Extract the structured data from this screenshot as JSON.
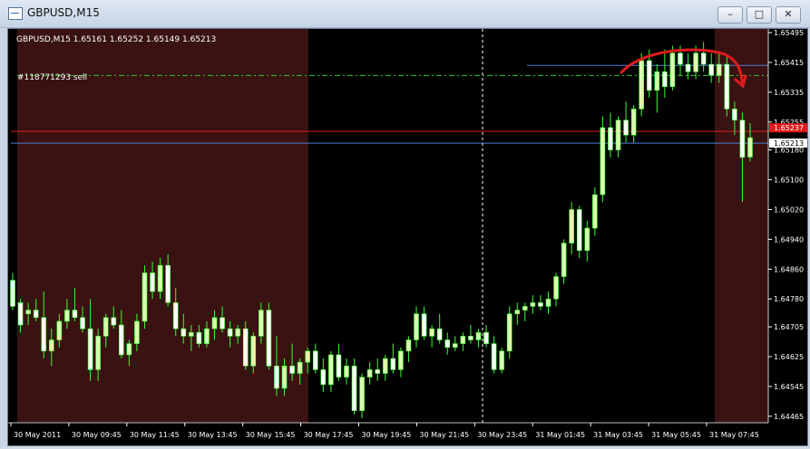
{
  "window": {
    "title": "GBPUSD,M15",
    "buttons": {
      "minimize": "–",
      "maximize": "□",
      "close": "✕"
    }
  },
  "chart_info": "GBPUSD,M15  1.65161 1.65252 1.65149 1.65213",
  "order_label": "#118771293 sell",
  "colors": {
    "background": "#000000",
    "session_shade": "#3a1212",
    "bull": "#d8ffb0",
    "bear": "#ffffff",
    "wick": "#37ff2b",
    "order_line": "#2ecc2e",
    "blue_line": "#4d7bd6",
    "red_line": "#e01b1b",
    "arrow": "#e01b1b"
  },
  "chart_data": {
    "type": "candlestick",
    "symbol": "GBPUSD",
    "timeframe": "M15",
    "ylim": [
      1.6445,
      1.655
    ],
    "y_ticks": [
      "1.65495",
      "1.65415",
      "1.65335",
      "1.65255",
      "1.65180",
      "1.65100",
      "1.65020",
      "1.64940",
      "1.64860",
      "1.64780",
      "1.64705",
      "1.64625",
      "1.64545",
      "1.64465"
    ],
    "x_ticks": [
      "30 May 2011",
      "30 May 09:45",
      "30 May 11:45",
      "30 May 13:45",
      "30 May 15:45",
      "30 May 17:45",
      "30 May 19:45",
      "30 May 21:45",
      "30 May 23:45",
      "31 May 01:45",
      "31 May 03:45",
      "31 May 05:45",
      "31 May 07:45"
    ],
    "price_labels": {
      "ask": "1.65237",
      "bid": "1.65213"
    },
    "levels": {
      "order_sell": 1.6538,
      "blue_upper": 1.6539,
      "red": 1.6523,
      "bid": 1.65213
    },
    "candles": [
      [
        1.6483,
        1.6485,
        1.6475,
        1.6476
      ],
      [
        1.6477,
        1.6478,
        1.6469,
        1.6471
      ],
      [
        1.6474,
        1.6477,
        1.6471,
        1.6475
      ],
      [
        1.6475,
        1.6478,
        1.6472,
        1.6473
      ],
      [
        1.6473,
        1.648,
        1.6462,
        1.6464
      ],
      [
        1.6464,
        1.647,
        1.646,
        1.6467
      ],
      [
        1.6467,
        1.6474,
        1.6465,
        1.6472
      ],
      [
        1.6472,
        1.6478,
        1.647,
        1.6475
      ],
      [
        1.6475,
        1.6481,
        1.6472,
        1.6473
      ],
      [
        1.6473,
        1.6476,
        1.6469,
        1.647
      ],
      [
        1.647,
        1.6478,
        1.6456,
        1.6459
      ],
      [
        1.6459,
        1.647,
        1.6456,
        1.6468
      ],
      [
        1.6468,
        1.6474,
        1.6465,
        1.6473
      ],
      [
        1.6473,
        1.6476,
        1.647,
        1.6471
      ],
      [
        1.6471,
        1.6475,
        1.6462,
        1.6463
      ],
      [
        1.6463,
        1.6467,
        1.646,
        1.6466
      ],
      [
        1.6466,
        1.6474,
        1.6464,
        1.6472
      ],
      [
        1.6472,
        1.6487,
        1.647,
        1.6485
      ],
      [
        1.6485,
        1.6488,
        1.6478,
        1.648
      ],
      [
        1.648,
        1.6489,
        1.6478,
        1.6487
      ],
      [
        1.6487,
        1.649,
        1.6476,
        1.6477
      ],
      [
        1.6477,
        1.6481,
        1.6468,
        1.647
      ],
      [
        1.647,
        1.6474,
        1.6466,
        1.6468
      ],
      [
        1.6468,
        1.6471,
        1.6464,
        1.6469
      ],
      [
        1.6469,
        1.6471,
        1.6465,
        1.6466
      ],
      [
        1.6466,
        1.6472,
        1.6465,
        1.647
      ],
      [
        1.647,
        1.6475,
        1.6467,
        1.6473
      ],
      [
        1.6473,
        1.6476,
        1.6469,
        1.647
      ],
      [
        1.647,
        1.6472,
        1.6465,
        1.6468
      ],
      [
        1.6468,
        1.6471,
        1.6466,
        1.647
      ],
      [
        1.647,
        1.6472,
        1.6459,
        1.646
      ],
      [
        1.646,
        1.6469,
        1.6458,
        1.6468
      ],
      [
        1.6468,
        1.6477,
        1.6466,
        1.6475
      ],
      [
        1.6475,
        1.6477,
        1.6459,
        1.646
      ],
      [
        1.646,
        1.6468,
        1.6452,
        1.6454
      ],
      [
        1.6454,
        1.6462,
        1.6452,
        1.646
      ],
      [
        1.646,
        1.6466,
        1.6456,
        1.6458
      ],
      [
        1.6458,
        1.6462,
        1.6455,
        1.6461
      ],
      [
        1.6461,
        1.6465,
        1.6458,
        1.6464
      ],
      [
        1.6464,
        1.6466,
        1.6458,
        1.6459
      ],
      [
        1.6459,
        1.6462,
        1.6453,
        1.6455
      ],
      [
        1.6455,
        1.6464,
        1.6453,
        1.6463
      ],
      [
        1.6463,
        1.6466,
        1.6456,
        1.6457
      ],
      [
        1.6457,
        1.6462,
        1.6455,
        1.646
      ],
      [
        1.646,
        1.6462,
        1.6447,
        1.6448
      ],
      [
        1.6448,
        1.6458,
        1.6446,
        1.6457
      ],
      [
        1.6457,
        1.6461,
        1.6455,
        1.6459
      ],
      [
        1.6459,
        1.6462,
        1.6456,
        1.6458
      ],
      [
        1.6458,
        1.6463,
        1.6456,
        1.6462
      ],
      [
        1.6462,
        1.6466,
        1.6458,
        1.6459
      ],
      [
        1.6459,
        1.6465,
        1.6457,
        1.6464
      ],
      [
        1.6464,
        1.6468,
        1.6461,
        1.6467
      ],
      [
        1.6467,
        1.6476,
        1.6465,
        1.6474
      ],
      [
        1.6474,
        1.6476,
        1.6467,
        1.6468
      ],
      [
        1.6468,
        1.6471,
        1.6465,
        1.647
      ],
      [
        1.647,
        1.6474,
        1.6466,
        1.6467
      ],
      [
        1.6467,
        1.6469,
        1.6463,
        1.6465
      ],
      [
        1.6465,
        1.6468,
        1.6464,
        1.6466
      ],
      [
        1.6466,
        1.6469,
        1.6464,
        1.6468
      ],
      [
        1.6468,
        1.6471,
        1.6466,
        1.6467
      ],
      [
        1.6467,
        1.647,
        1.6465,
        1.6469
      ],
      [
        1.6469,
        1.6471,
        1.6465,
        1.6466
      ],
      [
        1.6466,
        1.6468,
        1.6458,
        1.6459
      ],
      [
        1.6459,
        1.6465,
        1.6458,
        1.6464
      ],
      [
        1.6464,
        1.6476,
        1.6462,
        1.6474
      ],
      [
        1.6474,
        1.6477,
        1.6471,
        1.6475
      ],
      [
        1.6475,
        1.6477,
        1.6472,
        1.6476
      ],
      [
        1.6476,
        1.6479,
        1.6474,
        1.6477
      ],
      [
        1.6477,
        1.6479,
        1.6475,
        1.6476
      ],
      [
        1.6476,
        1.648,
        1.6474,
        1.6478
      ],
      [
        1.6478,
        1.6485,
        1.6476,
        1.6484
      ],
      [
        1.6484,
        1.6494,
        1.6482,
        1.6493
      ],
      [
        1.6493,
        1.6504,
        1.649,
        1.6502
      ],
      [
        1.6502,
        1.6503,
        1.6489,
        1.6491
      ],
      [
        1.6491,
        1.6499,
        1.6488,
        1.6497
      ],
      [
        1.6497,
        1.6508,
        1.6495,
        1.6506
      ],
      [
        1.6506,
        1.6527,
        1.6504,
        1.6524
      ],
      [
        1.6524,
        1.6528,
        1.6516,
        1.6518
      ],
      [
        1.6518,
        1.6527,
        1.6516,
        1.6526
      ],
      [
        1.6526,
        1.6531,
        1.652,
        1.6522
      ],
      [
        1.6522,
        1.653,
        1.652,
        1.6529
      ],
      [
        1.6529,
        1.6544,
        1.6527,
        1.6542
      ],
      [
        1.6542,
        1.6545,
        1.6532,
        1.6534
      ],
      [
        1.6534,
        1.6541,
        1.6528,
        1.6539
      ],
      [
        1.6539,
        1.6545,
        1.6532,
        1.6535
      ],
      [
        1.6535,
        1.6546,
        1.6534,
        1.6544
      ],
      [
        1.6544,
        1.6546,
        1.6538,
        1.6541
      ],
      [
        1.6541,
        1.6544,
        1.6537,
        1.6539
      ],
      [
        1.6539,
        1.6546,
        1.6537,
        1.6544
      ],
      [
        1.6544,
        1.6547,
        1.6539,
        1.6541
      ],
      [
        1.6541,
        1.6544,
        1.6536,
        1.6538
      ],
      [
        1.6538,
        1.6544,
        1.6536,
        1.6541
      ],
      [
        1.6541,
        1.6543,
        1.6527,
        1.6529
      ],
      [
        1.6529,
        1.6531,
        1.6522,
        1.6526
      ],
      [
        1.6526,
        1.6528,
        1.6504,
        1.6516
      ],
      [
        1.65161,
        1.65252,
        1.65149,
        1.65213
      ]
    ]
  }
}
